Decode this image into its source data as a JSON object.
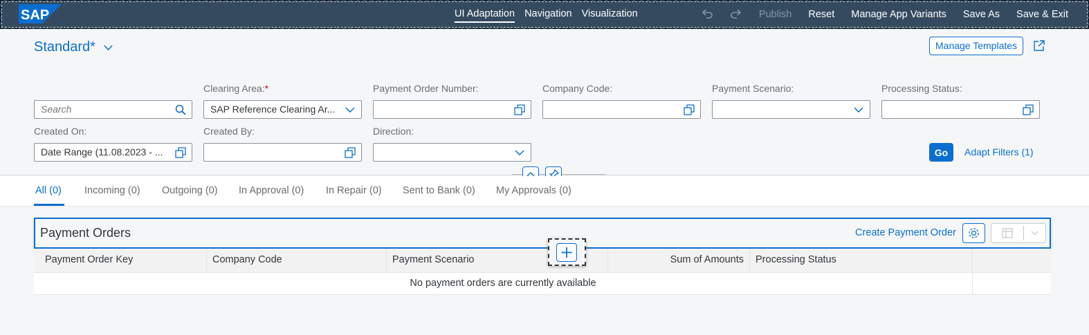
{
  "topbar": {
    "tabs": [
      {
        "label": "UI Adaptation",
        "active": true
      },
      {
        "label": "Navigation",
        "active": false
      },
      {
        "label": "Visualization",
        "active": false
      }
    ],
    "undo_icon": "undo-icon",
    "redo_icon": "redo-icon",
    "publish": "Publish",
    "reset": "Reset",
    "manage_variants": "Manage App Variants",
    "save_as": "Save As",
    "save_exit": "Save & Exit",
    "bg_color": "#354a5f"
  },
  "header": {
    "variant": "Standard*",
    "manage_templates": "Manage Templates",
    "go": "Go",
    "adapt_filters": "Adapt Filters (1)"
  },
  "filters": {
    "search_placeholder": "Search",
    "clearing_area_label": "Clearing Area:",
    "clearing_area_req": "*",
    "clearing_area_value": "SAP Reference Clearing Ar...",
    "payment_order_number_label": "Payment Order Number:",
    "company_code_label": "Company Code:",
    "payment_scenario_label": "Payment Scenario:",
    "processing_status_label": "Processing Status:",
    "created_on_label": "Created On:",
    "created_on_value": "Date Range (11.08.2023 - ...",
    "created_by_label": "Created By:",
    "direction_label": "Direction:"
  },
  "tabs": [
    {
      "label": "All (0)",
      "active": true
    },
    {
      "label": "Incoming (0)"
    },
    {
      "label": "Outgoing (0)"
    },
    {
      "label": "In Approval (0)"
    },
    {
      "label": "In Repair (0)"
    },
    {
      "label": "Sent to Bank (0)"
    },
    {
      "label": "My Approvals (0)"
    }
  ],
  "table": {
    "title": "Payment Orders",
    "create": "Create Payment Order",
    "columns": [
      "Payment Order Key",
      "Company Code",
      "Payment Scenario",
      "Sum of Amounts",
      "Processing Status"
    ],
    "no_data": "No payment orders are currently available"
  },
  "colors": {
    "accent": "#0a6ed1",
    "required": "#bb0000"
  }
}
